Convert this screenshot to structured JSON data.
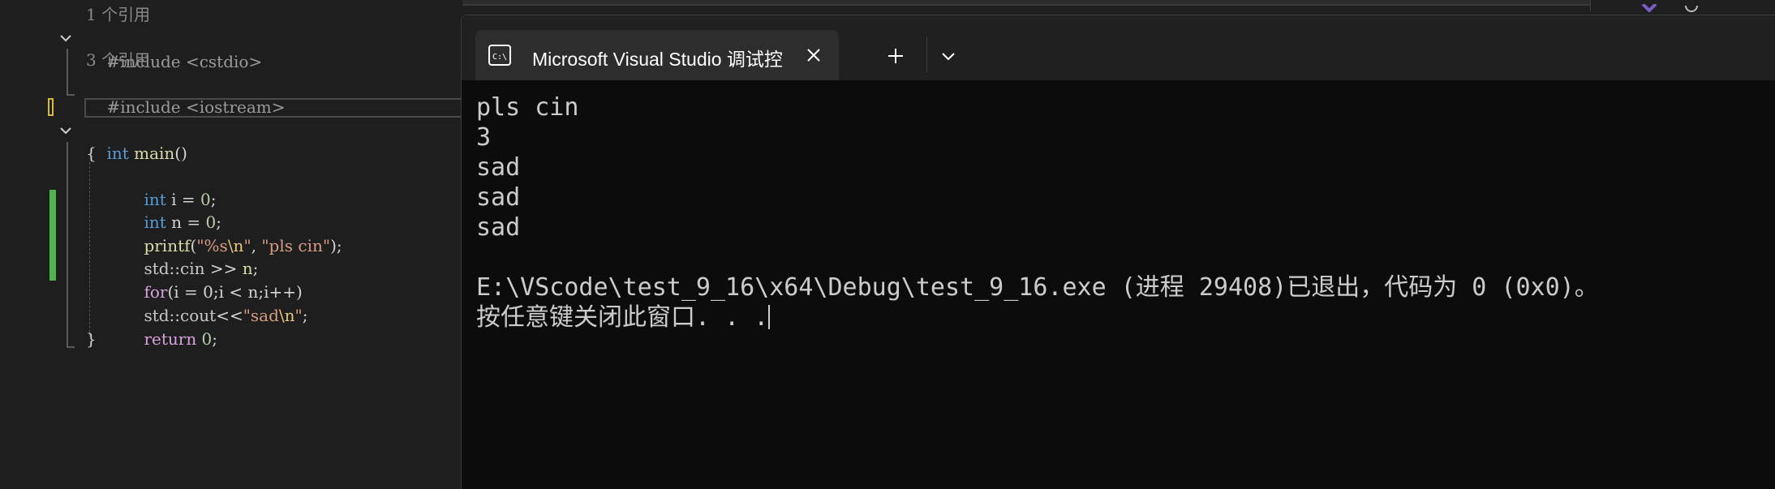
{
  "editor": {
    "codelens1": "1 个引用",
    "include1": {
      "directive": "#include",
      "header": "<cstdio>"
    },
    "codelens2": "3 个引用",
    "include2": {
      "directive": "#include",
      "header": "<iostream>"
    },
    "main_sig": {
      "type": "int",
      "name": "main",
      "parens": "()"
    },
    "open_brace": "{",
    "l_int_i": {
      "type": "int",
      "rest": " i = ",
      "num": "0",
      "semi": ";"
    },
    "l_int_n": {
      "type": "int",
      "rest": " n = ",
      "num": "0",
      "semi": ";"
    },
    "l_printf": {
      "fn": "printf",
      "open": "(",
      "s1": "\"%s",
      "esc": "\\n",
      "s1end": "\"",
      "comma": ", ",
      "s2": "\"pls cin\"",
      "close": ");"
    },
    "l_cin": {
      "ns": "std::cin",
      "op": " >> ",
      "var": "n",
      "semi": ";"
    },
    "l_for": {
      "kw": "for",
      "body": "(i = 0;i < n;i++)"
    },
    "l_cout": {
      "ns": "std::cout",
      "op": "<<",
      "s": "\"sad",
      "esc": "\\n",
      "send": "\"",
      "semi": ";"
    },
    "l_return": {
      "kw": "return",
      "num": " 0",
      "semi": ";"
    },
    "close_brace": "}"
  },
  "terminal": {
    "tab_title": "Microsoft Visual Studio 调试控",
    "icon": "console-icon",
    "lines": [
      "pls cin",
      "3",
      "sad",
      "sad",
      "sad",
      "",
      "E:\\VScode\\test_9_16\\x64\\Debug\\test_9_16.exe (进程 29408)已退出，代码为 0 (0x0)。",
      "按任意键关闭此窗口. . ."
    ]
  },
  "colors": {
    "editor_bg": "#1e1e1e",
    "terminal_bg": "#0c0c0c",
    "titlebar_bg": "#202020",
    "tab_bg": "#2d2d2d",
    "keyword": "#569cd6",
    "string": "#d69d85",
    "change_bar": "#4fb34f"
  }
}
